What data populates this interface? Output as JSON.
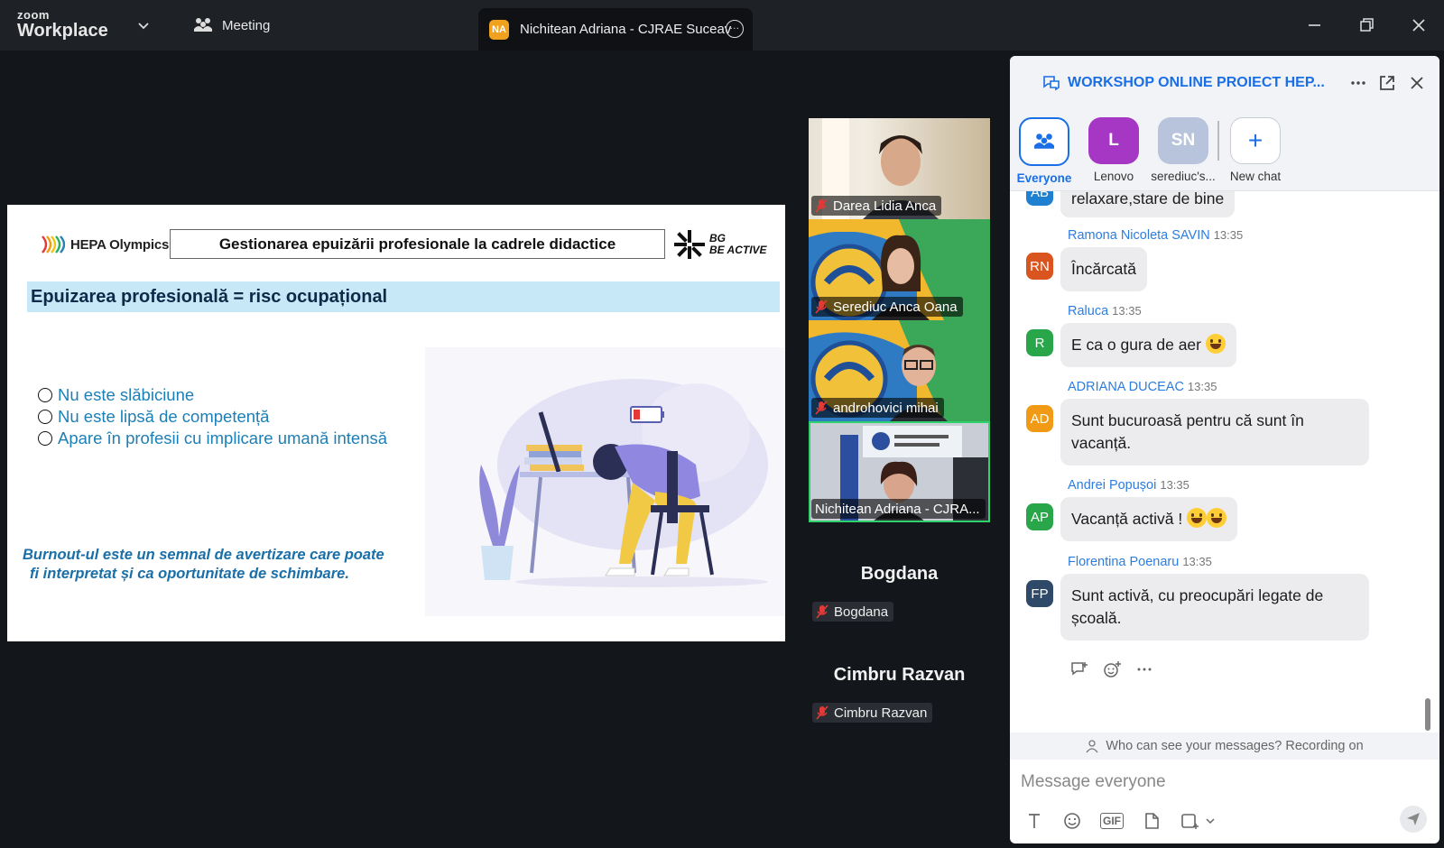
{
  "app": {
    "logo_top": "zoom",
    "logo_bottom": "Workplace",
    "meeting_label": "Meeting",
    "tab_avatar": "NA",
    "tab_title": "Nichitean Adriana - CJRAE Suceav"
  },
  "slide": {
    "hepa_logo_text": "HEPA Olympics",
    "title_box": "Gestionarea epuizării profesionale la cadrele didactice",
    "bg_logo_line1": "BG",
    "bg_logo_line2": "BE ACTIVE",
    "banner": "Epuizarea profesională = risc ocupațional",
    "bullets": [
      "Nu este slăbiciune",
      "Nu este lipsă de competență",
      "Apare în profesii cu implicare umană intensă"
    ],
    "note_line1": "Burnout-ul este un semnal de avertizare care poate",
    "note_line2": "fi interpretat și ca oportunitate de schimbare."
  },
  "video": {
    "tiles": [
      {
        "name": "Darea Lidia Anca"
      },
      {
        "name": "Serediuc Anca Oana"
      },
      {
        "name": "androhovici mihai"
      },
      {
        "name": "Nichitean Adriana - CJRA..."
      }
    ],
    "audio_only": [
      {
        "display": "Bogdana",
        "label": "Bogdana"
      },
      {
        "display": "Cimbru Razvan",
        "label": "Cimbru Razvan"
      }
    ]
  },
  "chat": {
    "title": "WORKSHOP ONLINE PROIECT HEP...",
    "targets": [
      {
        "initials": "",
        "label": "Everyone",
        "color": "#ffffff"
      },
      {
        "initials": "L",
        "label": "Lenovo",
        "color": "#a636c4"
      },
      {
        "initials": "SN",
        "label": "serediuc's...",
        "color": "#b7c4dc"
      },
      {
        "initials": "+",
        "label": "New chat",
        "color": "#ffffff"
      }
    ],
    "messages": [
      {
        "avatar": "AB",
        "avatar_color": "#1f7fd0",
        "name": "",
        "time": "",
        "text": "relaxare,stare de bine"
      },
      {
        "avatar": "RN",
        "avatar_color": "#d9541e",
        "name": "Ramona Nicoleta SAVIN",
        "time": "13:35",
        "text": "Încărcată"
      },
      {
        "avatar": "R",
        "avatar_color": "#2aa64a",
        "name": "Raluca",
        "time": "13:35",
        "text": "E ca o gura de aer"
      },
      {
        "avatar": "AD",
        "avatar_color": "#f09a16",
        "name": "ADRIANA DUCEAC",
        "time": "13:35",
        "text_l1": "Sunt bucuroasă pentru că sunt în",
        "text_l2": "vacanță."
      },
      {
        "avatar": "AP",
        "avatar_color": "#2aa64a",
        "name": "Andrei Popușoi",
        "time": "13:35",
        "text": "Vacanță activă !"
      },
      {
        "avatar": "FP",
        "avatar_color": "#2f4a68",
        "name": "Florentina Poenaru",
        "time": "13:35",
        "text_l1": "Sunt activă, cu preocupări legate de",
        "text_l2": "școală."
      }
    ],
    "privacy_note": "Who can see your messages? Recording on",
    "compose_placeholder": "Message everyone",
    "gif_label": "GIF"
  }
}
